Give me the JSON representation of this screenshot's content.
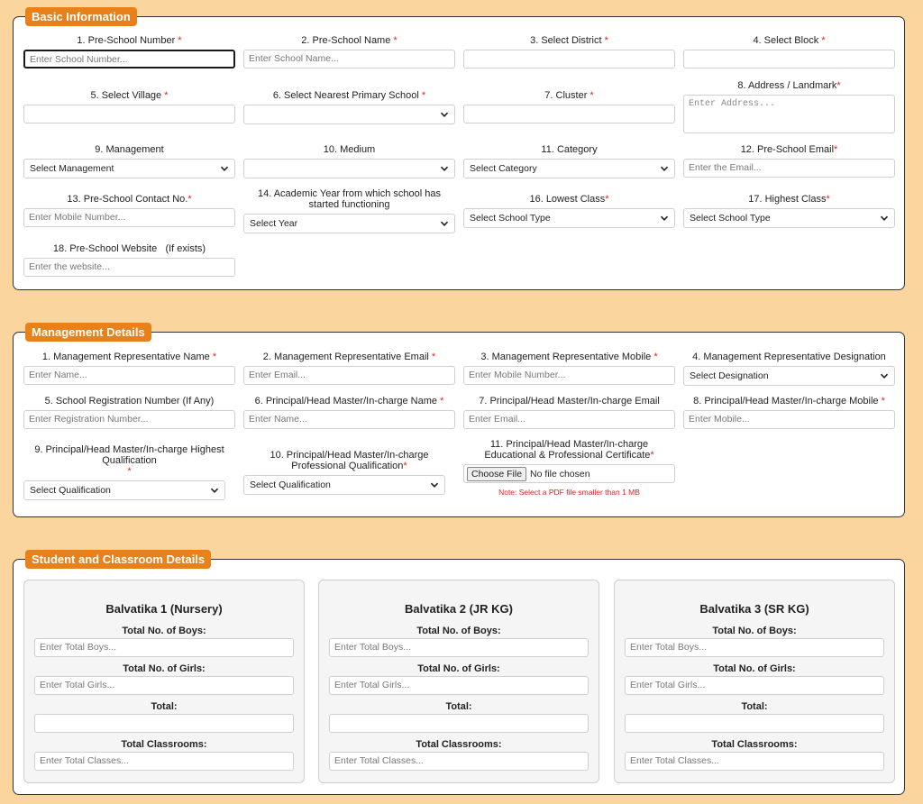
{
  "basic": {
    "title": "Basic Information",
    "fields": [
      {
        "label": "1. Pre-School Number",
        "required": "*",
        "placeholder": "Enter School Number..."
      },
      {
        "label": "2. Pre-School Name",
        "required": "*",
        "placeholder": "Enter School Name..."
      },
      {
        "label": "3. Select District",
        "required": "*",
        "placeholder": ""
      },
      {
        "label": "4. Select Block",
        "required": "*",
        "placeholder": ""
      },
      {
        "label": "5. Select Village",
        "required": "*",
        "placeholder": ""
      },
      {
        "label": "6. Select Nearest Primary School",
        "required": "*",
        "value": ""
      },
      {
        "label": "7. Cluster",
        "required": "*",
        "placeholder": ""
      },
      {
        "label": "8. Address / Landmark",
        "required": "*",
        "placeholder": "Enter Address..."
      },
      {
        "label": "9. Management",
        "required": "",
        "value": "Select Management"
      },
      {
        "label": "10. Medium",
        "required": "",
        "value": ""
      },
      {
        "label": "11. Category",
        "required": "",
        "value": "Select Category"
      },
      {
        "label": "12. Pre-School Email",
        "required": "*",
        "placeholder": "Enter the Email..."
      },
      {
        "label": "13. Pre-School Contact No.",
        "required": "*",
        "placeholder": "Enter Mobile Number..."
      },
      {
        "label": "14. Academic Year from which school has started functioning",
        "required": "",
        "value": "Select Year"
      },
      {
        "label": "16. Lowest Class",
        "required": "*",
        "value": "Select School Type"
      },
      {
        "label": "17. Highest Class",
        "required": "*",
        "value": "Select School Type"
      },
      {
        "label": "18. Pre-School Website   (If exists)",
        "required": "",
        "placeholder": "Enter the website..."
      }
    ]
  },
  "management": {
    "title": "Management Details",
    "fields": [
      {
        "label": "1. Management Representative Name",
        "required": "*",
        "placeholder": "Enter Name..."
      },
      {
        "label": "2. Management Representative Email",
        "required": "*",
        "placeholder": "Enter Email..."
      },
      {
        "label": "3. Management Representative Mobile",
        "required": "*",
        "placeholder": "Enter Mobile Number..."
      },
      {
        "label": "4. Management Representative Designation",
        "required": "",
        "value": "Select Designation"
      },
      {
        "label": "5. School Registration Number (If Any)",
        "required": "",
        "placeholder": "Enter Registration Number..."
      },
      {
        "label": "6. Principal/Head Master/In-charge Name",
        "required": "*",
        "placeholder": "Enter Name..."
      },
      {
        "label": "7. Principal/Head Master/In-charge Email",
        "required": "",
        "placeholder": "Enter Email..."
      },
      {
        "label": "8. Principal/Head Master/In-charge Mobile",
        "required": "*",
        "placeholder": "Enter Mobile..."
      },
      {
        "label": "9. Principal/Head Master/In-charge Highest Qualification",
        "required": "*",
        "value": "Select Qualification"
      },
      {
        "label": "10. Principal/Head Master/In-charge Professional Qualification",
        "required": "*",
        "value": "Select Qualification"
      },
      {
        "label": "11. Principal/Head Master/In-charge Educational & Professional Certificate",
        "required": "*",
        "button": "Choose File",
        "file_status": "No file chosen",
        "note": "Note: Select a PDF file smaller than 1 MB"
      }
    ]
  },
  "students": {
    "title": "Student and Classroom Details",
    "labels": {
      "boys": "Total No. of Boys:",
      "girls": "Total No. of Girls:",
      "total": "Total:",
      "classrooms": "Total Classrooms:"
    },
    "placeholders": {
      "boys": "Enter Total Boys...",
      "girls": "Enter Total Girls...",
      "total": "",
      "classrooms": "Enter Total Classes..."
    },
    "cards": [
      {
        "title": "Balvatika 1 (Nursery)"
      },
      {
        "title": "Balvatika 2 (JR KG)"
      },
      {
        "title": "Balvatika 3 (SR KG)"
      }
    ]
  }
}
